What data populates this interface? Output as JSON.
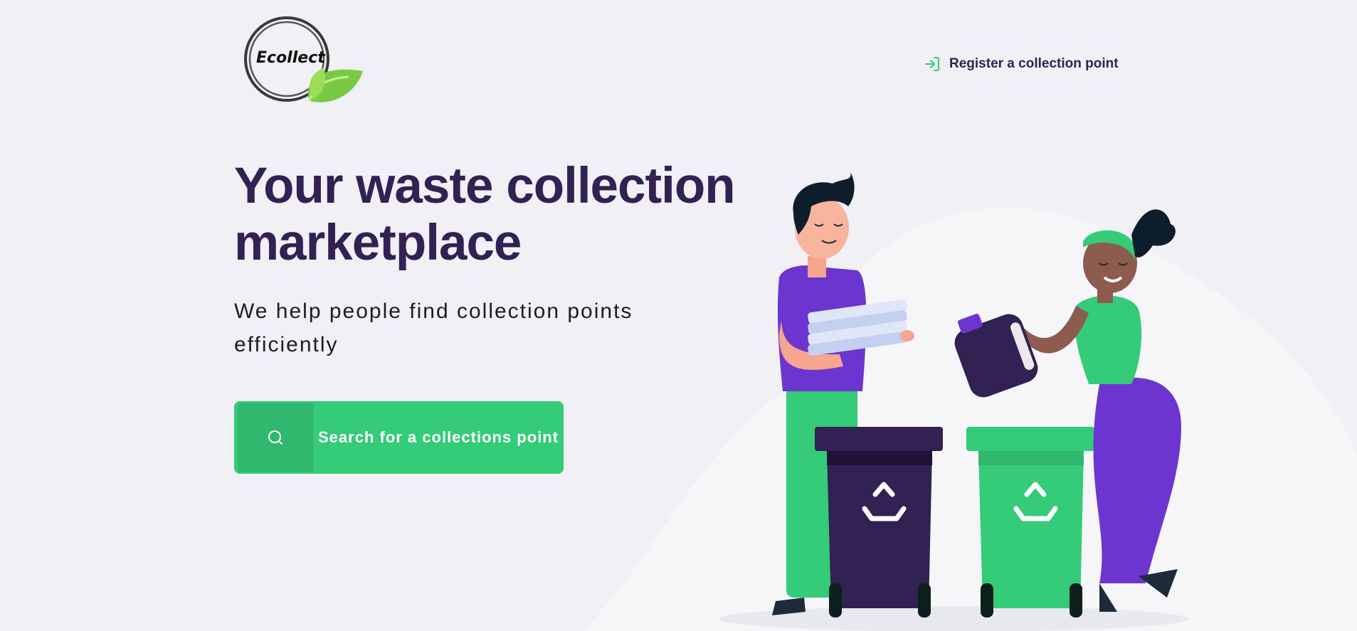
{
  "header": {
    "logo_text": "Ecollect",
    "register_link": {
      "icon": "log-in-icon",
      "label": "Register a collection point"
    }
  },
  "hero": {
    "title": "Your waste collection marketplace",
    "subtitle": "We help people find collection points efficiently",
    "search_button": {
      "icon": "search-icon",
      "label": "Search for a collections point"
    }
  },
  "colors": {
    "primary": "#34cb79",
    "primary_dark": "#2fb86e",
    "title": "#322153",
    "background": "#f0f0f5",
    "purple": "#6c35d0"
  }
}
